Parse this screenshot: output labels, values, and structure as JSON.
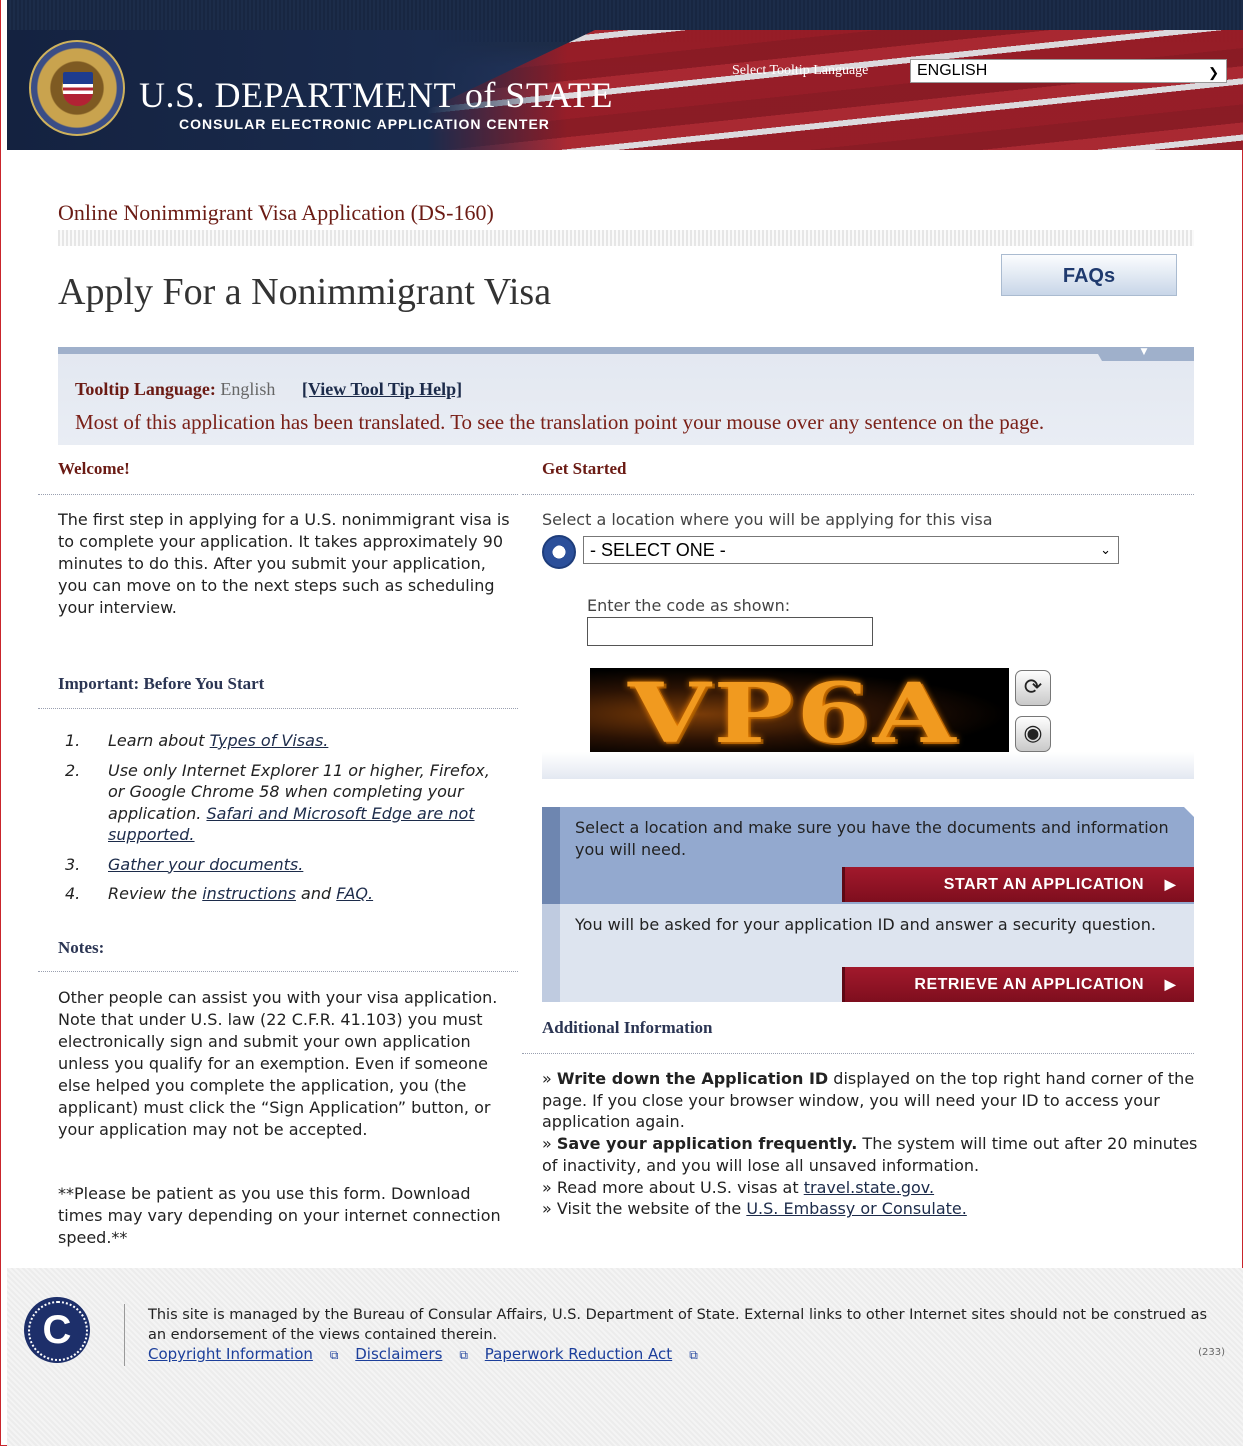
{
  "header": {
    "title": "U.S. DEPARTMENT of STATE",
    "subtitle": "CONSULAR ELECTRONIC APPLICATION CENTER",
    "tooltip_language_label": "Select Tooltip Language",
    "tooltip_language_value": "ENGLISH"
  },
  "page": {
    "subtitle": "Online Nonimmigrant Visa Application (DS-160)",
    "title": "Apply For a Nonimmigrant Visa",
    "faq_button": "FAQs"
  },
  "tooltip_bar": {
    "label": "Tooltip Language:",
    "value": "English",
    "help_link": "[View Tool Tip Help]",
    "message": "Most of this application has been translated. To see the translation point your mouse over any sentence on the page."
  },
  "left": {
    "welcome_heading": "Welcome!",
    "welcome_text": "The first step in applying for a U.S. nonimmigrant visa is to complete your application. It takes approximately 90 minutes to do this. After you submit your application, you can move on to the next steps such as scheduling your interview.",
    "important_heading": "Important: Before You Start",
    "steps": [
      {
        "num": "1.",
        "pre": "Learn about ",
        "link": "Types of Visas.",
        "post": ""
      },
      {
        "num": "2.",
        "pre": "Use only Internet Explorer 11 or higher, Firefox, or Google Chrome 58 when completing your application. ",
        "link": "Safari and Microsoft Edge are not supported.",
        "post": ""
      },
      {
        "num": "3.",
        "pre": "",
        "link": "Gather your documents.",
        "post": ""
      },
      {
        "num": "4.",
        "pre": "Review the ",
        "link": "instructions",
        "mid": " and ",
        "link2": "FAQ."
      }
    ],
    "notes_heading": "Notes:",
    "notes_text": "Other people can assist you with your visa application. Note that under U.S. law (22 C.F.R. 41.103) you must electronically sign and submit your own application unless you qualify for an exemption. Even if someone else helped you complete the application, you (the applicant) must click the “Sign Application” button, or your application may not be accepted.",
    "patience_text": "**Please be patient as you use this form. Download times may vary depending on your internet connection speed.**"
  },
  "right": {
    "get_started_heading": "Get Started",
    "location_label": "Select a location where you will be applying for this visa",
    "location_value": "- SELECT ONE -",
    "code_label": "Enter the code as shown:",
    "code_value": "",
    "captcha_text": "VP6A",
    "start_text": "Select a location and make sure you have the documents and information you will need.",
    "start_button": "START AN APPLICATION",
    "retrieve_text": "You will be asked for your application ID and answer a security question.",
    "retrieve_button": "RETRIEVE AN APPLICATION",
    "additional_heading": "Additional Information",
    "info": {
      "i1_bold": "Write down the Application ID",
      "i1_rest": " displayed on the top right hand corner of the page. If you close your browser window, you will need your ID to access your application again.",
      "i2_bold": "Save your application frequently.",
      "i2_rest": " The system will time out after 20 minutes of inactivity, and you will lose all unsaved information.",
      "i3_pre": "Read more about U.S. visas at ",
      "i3_link": "travel.state.gov.",
      "i4_pre": "Visit the website of the ",
      "i4_link": "U.S. Embassy or Consulate."
    }
  },
  "footer": {
    "text": "This site is managed by the Bureau of Consular Affairs, U.S. Department of State. External links to other Internet sites should not be construed as an endorsement of the views contained therein.",
    "links": [
      "Copyright Information",
      "Disclaimers",
      "Paperwork Reduction Act"
    ],
    "counter": "(233)"
  },
  "colors": {
    "brand_red": "#6b1b14",
    "nav_blue": "#1d2c47",
    "button_red": "#a2192c"
  }
}
